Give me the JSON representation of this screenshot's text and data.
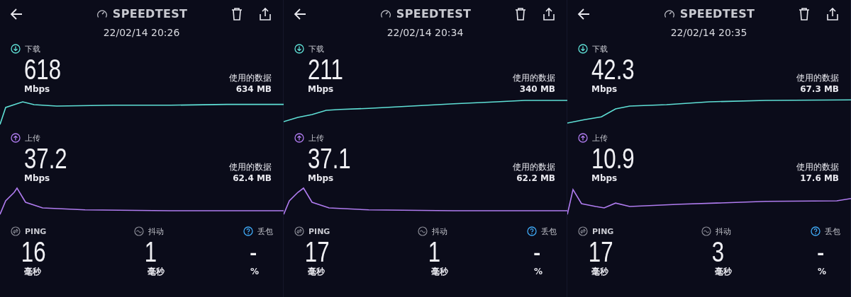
{
  "panels": [
    {
      "header": {
        "title": "SPEEDTEST",
        "datetime": "22/02/14 20:26"
      },
      "download": {
        "label": "下载",
        "value": "618",
        "unit": "Mbps",
        "data_label": "使用的数据",
        "data_value": "634 MB"
      },
      "upload": {
        "label": "上传",
        "value": "37.2",
        "unit": "Mbps",
        "data_label": "使用的数据",
        "data_value": "62.4 MB"
      },
      "metrics": [
        {
          "kind": "ping",
          "label": "PING",
          "value": "16",
          "unit": "毫秒"
        },
        {
          "kind": "jitter",
          "label": "抖动",
          "value": "1",
          "unit": "毫秒"
        },
        {
          "kind": "loss",
          "label": "丢包",
          "value": "-",
          "unit": "%"
        }
      ]
    },
    {
      "header": {
        "title": "SPEEDTEST",
        "datetime": "22/02/14 20:34"
      },
      "download": {
        "label": "下载",
        "value": "211",
        "unit": "Mbps",
        "data_label": "使用的数据",
        "data_value": "340 MB"
      },
      "upload": {
        "label": "上传",
        "value": "37.1",
        "unit": "Mbps",
        "data_label": "使用的数据",
        "data_value": "62.2 MB"
      },
      "metrics": [
        {
          "kind": "ping",
          "label": "PING",
          "value": "17",
          "unit": "毫秒"
        },
        {
          "kind": "jitter",
          "label": "抖动",
          "value": "1",
          "unit": "毫秒"
        },
        {
          "kind": "loss",
          "label": "丢包",
          "value": "-",
          "unit": "%"
        }
      ]
    },
    {
      "header": {
        "title": "SPEEDTEST",
        "datetime": "22/02/14 20:35"
      },
      "download": {
        "label": "下载",
        "value": "42.3",
        "unit": "Mbps",
        "data_label": "使用的数据",
        "data_value": "67.3 MB"
      },
      "upload": {
        "label": "上传",
        "value": "10.9",
        "unit": "Mbps",
        "data_label": "使用的数据",
        "data_value": "17.6 MB"
      },
      "metrics": [
        {
          "kind": "ping",
          "label": "PING",
          "value": "17",
          "unit": "毫秒"
        },
        {
          "kind": "jitter",
          "label": "抖动",
          "value": "3",
          "unit": "毫秒"
        },
        {
          "kind": "loss",
          "label": "丢包",
          "value": "-",
          "unit": "%"
        }
      ]
    }
  ]
}
